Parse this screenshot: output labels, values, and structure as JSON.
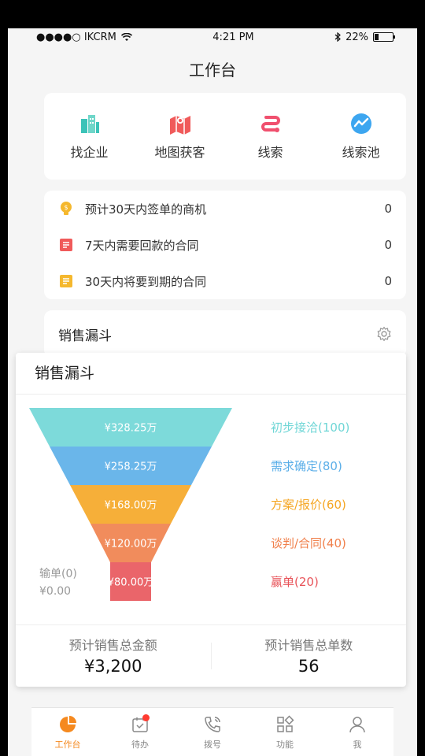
{
  "status": {
    "carrier": "●●●●○ IKCRM",
    "time": "4:21 PM",
    "battery": "22%",
    "battery_level": 0.22
  },
  "nav": {
    "title": "工作台"
  },
  "quick": [
    {
      "label": "找企业",
      "icon": "building-icon"
    },
    {
      "label": "地图获客",
      "icon": "map-icon"
    },
    {
      "label": "线索",
      "icon": "leads-icon"
    },
    {
      "label": "线索池",
      "icon": "lead-pool-icon"
    }
  ],
  "stats": [
    {
      "label": "预计30天内签单的商机",
      "value": "0",
      "icon": "lightbulb-icon"
    },
    {
      "label": "7天内需要回款的合同",
      "value": "0",
      "icon": "contract-red-icon"
    },
    {
      "label": "30天内将要到期的合同",
      "value": "0",
      "icon": "contract-yellow-icon"
    }
  ],
  "funnel_section": {
    "title": "销售漏斗"
  },
  "modal": {
    "title": "销售漏斗",
    "stages": [
      {
        "amount": "¥328.25万",
        "label": "初步接洽(100)",
        "color": "#6fd6d6"
      },
      {
        "amount": "¥258.25万",
        "label": "需求确定(80)",
        "color": "#5aaee8"
      },
      {
        "amount": "¥168.00万",
        "label": "方案/报价(60)",
        "color": "#f5a623"
      },
      {
        "amount": "¥120.00万",
        "label": "谈判/合同(40)",
        "color": "#f07f4a"
      },
      {
        "amount": "¥80.00万",
        "label": "赢单(20)",
        "color": "#e8545a"
      }
    ],
    "lost_label": "输单(0)",
    "lost_amount": "¥0.00",
    "total_amount_label": "预计销售总金额",
    "total_amount": "¥3,200",
    "total_count_label": "预计销售总单数",
    "total_count": "56"
  },
  "tabs": [
    {
      "label": "工作台",
      "icon": "dashboard-icon",
      "active": true
    },
    {
      "label": "待办",
      "icon": "todo-icon",
      "badge": true
    },
    {
      "label": "拨号",
      "icon": "phone-icon"
    },
    {
      "label": "功能",
      "icon": "apps-icon"
    },
    {
      "label": "我",
      "icon": "user-icon"
    }
  ]
}
